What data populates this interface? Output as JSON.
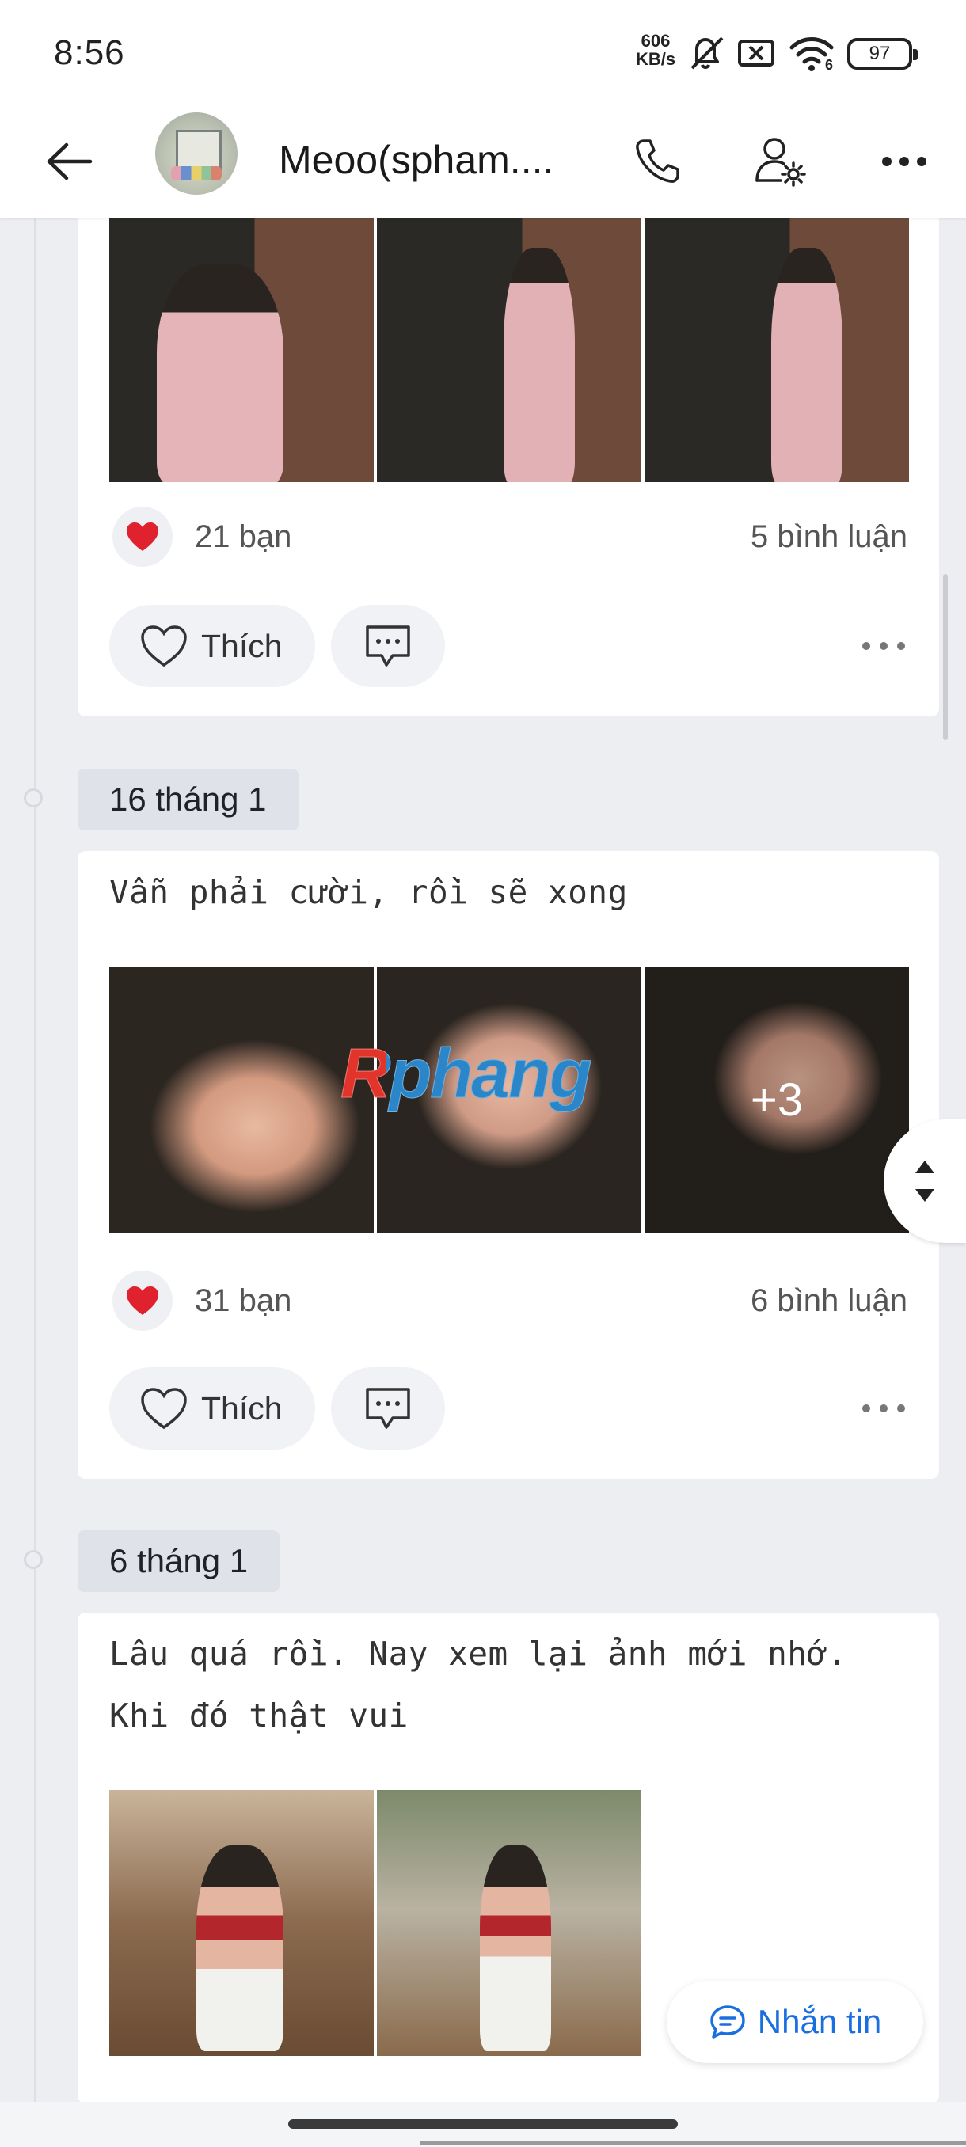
{
  "status_bar": {
    "time": "8:56",
    "net_speed_value": "606",
    "net_speed_unit": "KB/s",
    "wifi_label": "6",
    "battery": "97",
    "icons": [
      "mute-icon",
      "close-box-icon",
      "wifi-icon",
      "battery-icon"
    ]
  },
  "header": {
    "contact_name": "Meoo(spham....",
    "icons": [
      "back-arrow-icon",
      "phone-icon",
      "user-settings-icon",
      "more-horizontal-icon"
    ]
  },
  "posts": [
    {
      "date": "",
      "caption": "",
      "photo_count_shown": 3,
      "reactions": "21 bạn",
      "comments": "5 bình luận",
      "like_label": "Thích"
    },
    {
      "date": "16 tháng 1",
      "caption": "Vẫn phải cười, rồi sẽ xong",
      "more_photos": "+3",
      "watermark": "Rphang",
      "reactions": "31 bạn",
      "comments": "6 bình luận",
      "like_label": "Thích"
    },
    {
      "date": "6 tháng 1",
      "caption_line1": "Lâu quá rồi. Nay xem lại ảnh mới nhớ.",
      "caption_line2": "Khi đó thật vui",
      "photo_count_shown": 2
    }
  ],
  "message_button": {
    "label": "Nhắn tin",
    "icon": "chat-bubble-icon"
  },
  "colors": {
    "accent": "#1a6fe0",
    "heart": "#e0212e",
    "background": "#eceef2"
  }
}
